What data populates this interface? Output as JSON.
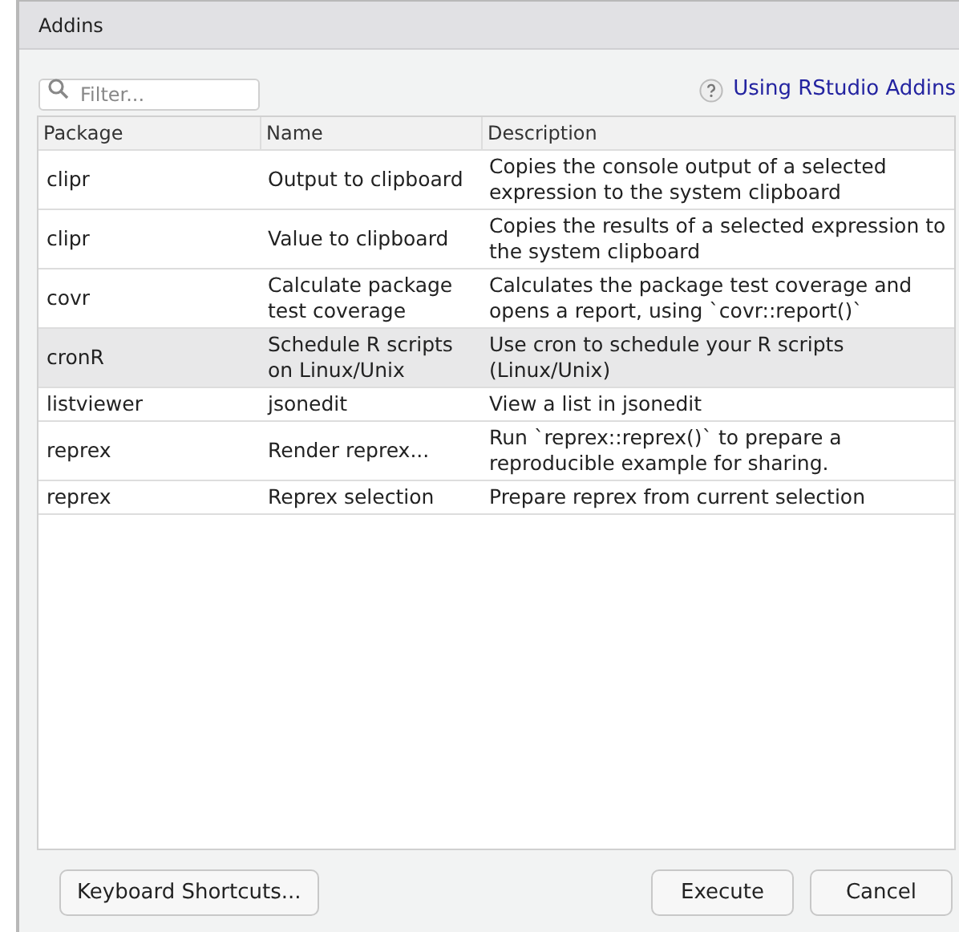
{
  "window": {
    "title": "Addins"
  },
  "filter": {
    "placeholder": "Filter..."
  },
  "help_link": {
    "label": "Using RStudio Addins"
  },
  "table": {
    "columns": [
      "Package",
      "Name",
      "Description"
    ],
    "rows": [
      {
        "package": "clipr",
        "name": "Output to clipboard",
        "description": "Copies the console output of a selected expression to the system clipboard",
        "selected": false
      },
      {
        "package": "clipr",
        "name": "Value to clipboard",
        "description": "Copies the results of a selected expression to the system clipboard",
        "selected": false
      },
      {
        "package": "covr",
        "name": "Calculate package test coverage",
        "description": "Calculates the package test coverage and opens a report, using `covr::report()`",
        "selected": false
      },
      {
        "package": "cronR",
        "name": "Schedule R scripts on Linux/Unix",
        "description": "Use cron to schedule your R scripts (Linux/Unix)",
        "selected": true
      },
      {
        "package": "listviewer",
        "name": "jsonedit",
        "description": "View a list in jsonedit",
        "selected": false
      },
      {
        "package": "reprex",
        "name": "Render reprex...",
        "description": "Run `reprex::reprex()` to prepare a reproducible example for sharing.",
        "selected": false
      },
      {
        "package": "reprex",
        "name": "Reprex selection",
        "description": "Prepare reprex from current selection",
        "selected": false
      }
    ]
  },
  "buttons": {
    "shortcuts": "Keyboard Shortcuts...",
    "execute": "Execute",
    "cancel": "Cancel"
  }
}
